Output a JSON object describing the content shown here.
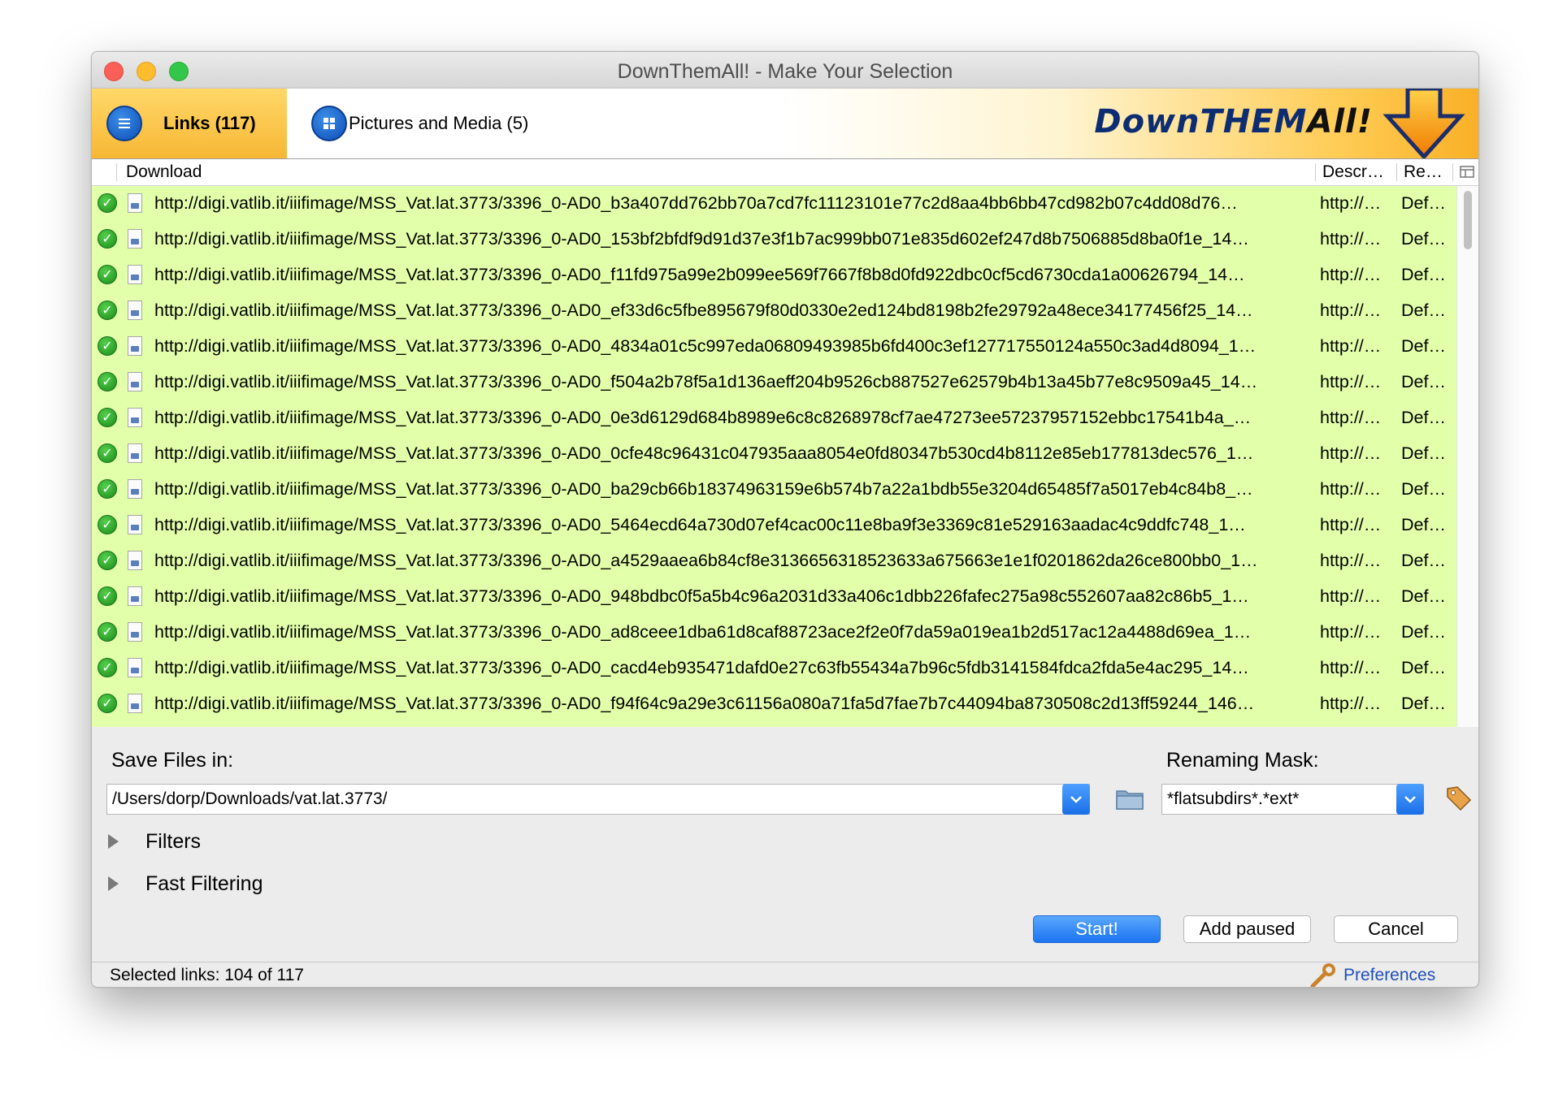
{
  "window": {
    "title": "DownThemAll! - Make Your Selection"
  },
  "tabs": [
    {
      "label": "Links (117)",
      "active": true,
      "icon": "list-icon"
    },
    {
      "label": "Pictures and Media (5)",
      "active": false,
      "icon": "grid-icon"
    }
  ],
  "logo": {
    "part1": "DownTHEM",
    "part2": "All!"
  },
  "columns": {
    "download": "Download",
    "description": "Descr…",
    "renaming": "Re…"
  },
  "rows": [
    {
      "url": "http://digi.vatlib.it/iiifimage/MSS_Vat.lat.3773/3396_0-AD0_b3a407dd762bb70a7cd7fc11123101e77c2d8aa4bb6bb47cd982b07c4dd08d76…",
      "desc": "http://…",
      "ren": "Def…"
    },
    {
      "url": "http://digi.vatlib.it/iiifimage/MSS_Vat.lat.3773/3396_0-AD0_153bf2bfdf9d91d37e3f1b7ac999bb071e835d602ef247d8b7506885d8ba0f1e_14…",
      "desc": "http://…",
      "ren": "Def…"
    },
    {
      "url": "http://digi.vatlib.it/iiifimage/MSS_Vat.lat.3773/3396_0-AD0_f11fd975a99e2b099ee569f7667f8b8d0fd922dbc0cf5cd6730cda1a00626794_14…",
      "desc": "http://…",
      "ren": "Def…"
    },
    {
      "url": "http://digi.vatlib.it/iiifimage/MSS_Vat.lat.3773/3396_0-AD0_ef33d6c5fbe895679f80d0330e2ed124bd8198b2fe29792a48ece34177456f25_14…",
      "desc": "http://…",
      "ren": "Def…"
    },
    {
      "url": "http://digi.vatlib.it/iiifimage/MSS_Vat.lat.3773/3396_0-AD0_4834a01c5c997eda06809493985b6fd400c3ef127717550124a550c3ad4d8094_1…",
      "desc": "http://…",
      "ren": "Def…"
    },
    {
      "url": "http://digi.vatlib.it/iiifimage/MSS_Vat.lat.3773/3396_0-AD0_f504a2b78f5a1d136aeff204b9526cb887527e62579b4b13a45b77e8c9509a45_14…",
      "desc": "http://…",
      "ren": "Def…"
    },
    {
      "url": "http://digi.vatlib.it/iiifimage/MSS_Vat.lat.3773/3396_0-AD0_0e3d6129d684b8989e6c8c8268978cf7ae47273ee57237957152ebbc17541b4a_…",
      "desc": "http://…",
      "ren": "Def…"
    },
    {
      "url": "http://digi.vatlib.it/iiifimage/MSS_Vat.lat.3773/3396_0-AD0_0cfe48c96431c047935aaa8054e0fd80347b530cd4b8112e85eb177813dec576_1…",
      "desc": "http://…",
      "ren": "Def…"
    },
    {
      "url": "http://digi.vatlib.it/iiifimage/MSS_Vat.lat.3773/3396_0-AD0_ba29cb66b18374963159e6b574b7a22a1bdb55e3204d65485f7a5017eb4c84b8_…",
      "desc": "http://…",
      "ren": "Def…"
    },
    {
      "url": "http://digi.vatlib.it/iiifimage/MSS_Vat.lat.3773/3396_0-AD0_5464ecd64a730d07ef4cac00c11e8ba9f3e3369c81e529163aadac4c9ddfc748_1…",
      "desc": "http://…",
      "ren": "Def…"
    },
    {
      "url": "http://digi.vatlib.it/iiifimage/MSS_Vat.lat.3773/3396_0-AD0_a4529aaea6b84cf8e3136656318523633a675663e1e1f0201862da26ce800bb0_1…",
      "desc": "http://…",
      "ren": "Def…"
    },
    {
      "url": "http://digi.vatlib.it/iiifimage/MSS_Vat.lat.3773/3396_0-AD0_948bdbc0f5a5b4c96a2031d33a406c1dbb226fafec275a98c552607aa82c86b5_1…",
      "desc": "http://…",
      "ren": "Def…"
    },
    {
      "url": "http://digi.vatlib.it/iiifimage/MSS_Vat.lat.3773/3396_0-AD0_ad8ceee1dba61d8caf88723ace2f2e0f7da59a019ea1b2d517ac12a4488d69ea_1…",
      "desc": "http://…",
      "ren": "Def…"
    },
    {
      "url": "http://digi.vatlib.it/iiifimage/MSS_Vat.lat.3773/3396_0-AD0_cacd4eb935471dafd0e27c63fb55434a7b96c5fdb3141584fdca2fda5e4ac295_14…",
      "desc": "http://…",
      "ren": "Def…"
    },
    {
      "url": "http://digi.vatlib.it/iiifimage/MSS_Vat.lat.3773/3396_0-AD0_f94f64c9a29e3c61156a080a71fa5d7fae7b7c44094ba8730508c2d13ff59244_146…",
      "desc": "http://…",
      "ren": "Def…"
    }
  ],
  "save": {
    "label": "Save Files in:",
    "path": "/Users/dorp/Downloads/vat.lat.3773/"
  },
  "renaming": {
    "label": "Renaming Mask:",
    "mask": "*flatsubdirs*.*ext*"
  },
  "sections": {
    "filters": "Filters",
    "fast_filtering": "Fast Filtering"
  },
  "buttons": {
    "start": "Start!",
    "add_paused": "Add paused",
    "cancel": "Cancel"
  },
  "status": {
    "selected": "Selected links: 104 of 117",
    "preferences": "Preferences"
  },
  "colors": {
    "row_selected": "#e2ffaa",
    "accent_blue": "#1c74f0",
    "tab_active": "#f7b735",
    "link": "#1f4fb8"
  }
}
